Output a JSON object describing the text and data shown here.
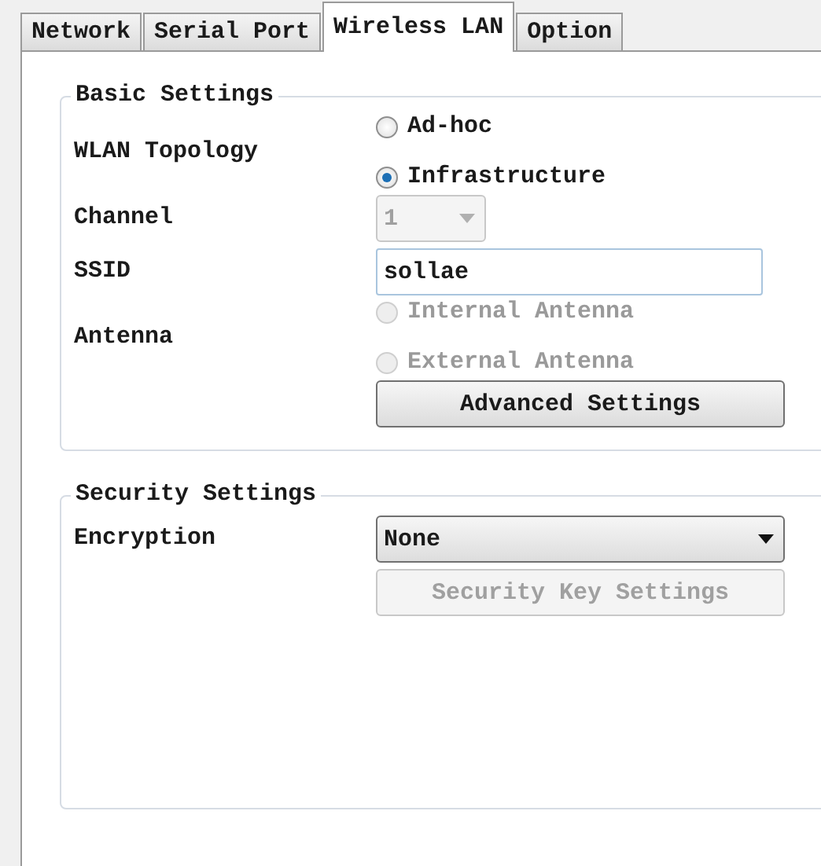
{
  "tabs": [
    {
      "label": "Network",
      "selected": false
    },
    {
      "label": "Serial Port",
      "selected": false
    },
    {
      "label": "Wireless LAN",
      "selected": true
    },
    {
      "label": "Option",
      "selected": false
    }
  ],
  "groups": [
    {
      "title": "Basic Settings",
      "rows": [
        {
          "kind": "radio",
          "label": "WLAN Topology",
          "disabled": false,
          "options": [
            {
              "label": "Ad-hoc",
              "selected": false
            },
            {
              "label": "Infrastructure",
              "selected": true
            }
          ]
        },
        {
          "kind": "combo",
          "label": "Channel",
          "value": "1",
          "disabled": true
        },
        {
          "kind": "text",
          "label": "SSID",
          "value": "sollae"
        },
        {
          "kind": "radio",
          "label": "Antenna",
          "disabled": true,
          "options": [
            {
              "label": "Internal Antenna",
              "selected": false
            },
            {
              "label": "External Antenna",
              "selected": false
            }
          ]
        },
        {
          "kind": "button",
          "label": "Advanced Settings",
          "disabled": false
        }
      ]
    },
    {
      "title": "Security Settings",
      "rows": [
        {
          "kind": "combo",
          "label": "Encryption",
          "value": "None",
          "disabled": false
        },
        {
          "kind": "button",
          "label": "Security Key Settings",
          "disabled": true
        }
      ]
    }
  ]
}
